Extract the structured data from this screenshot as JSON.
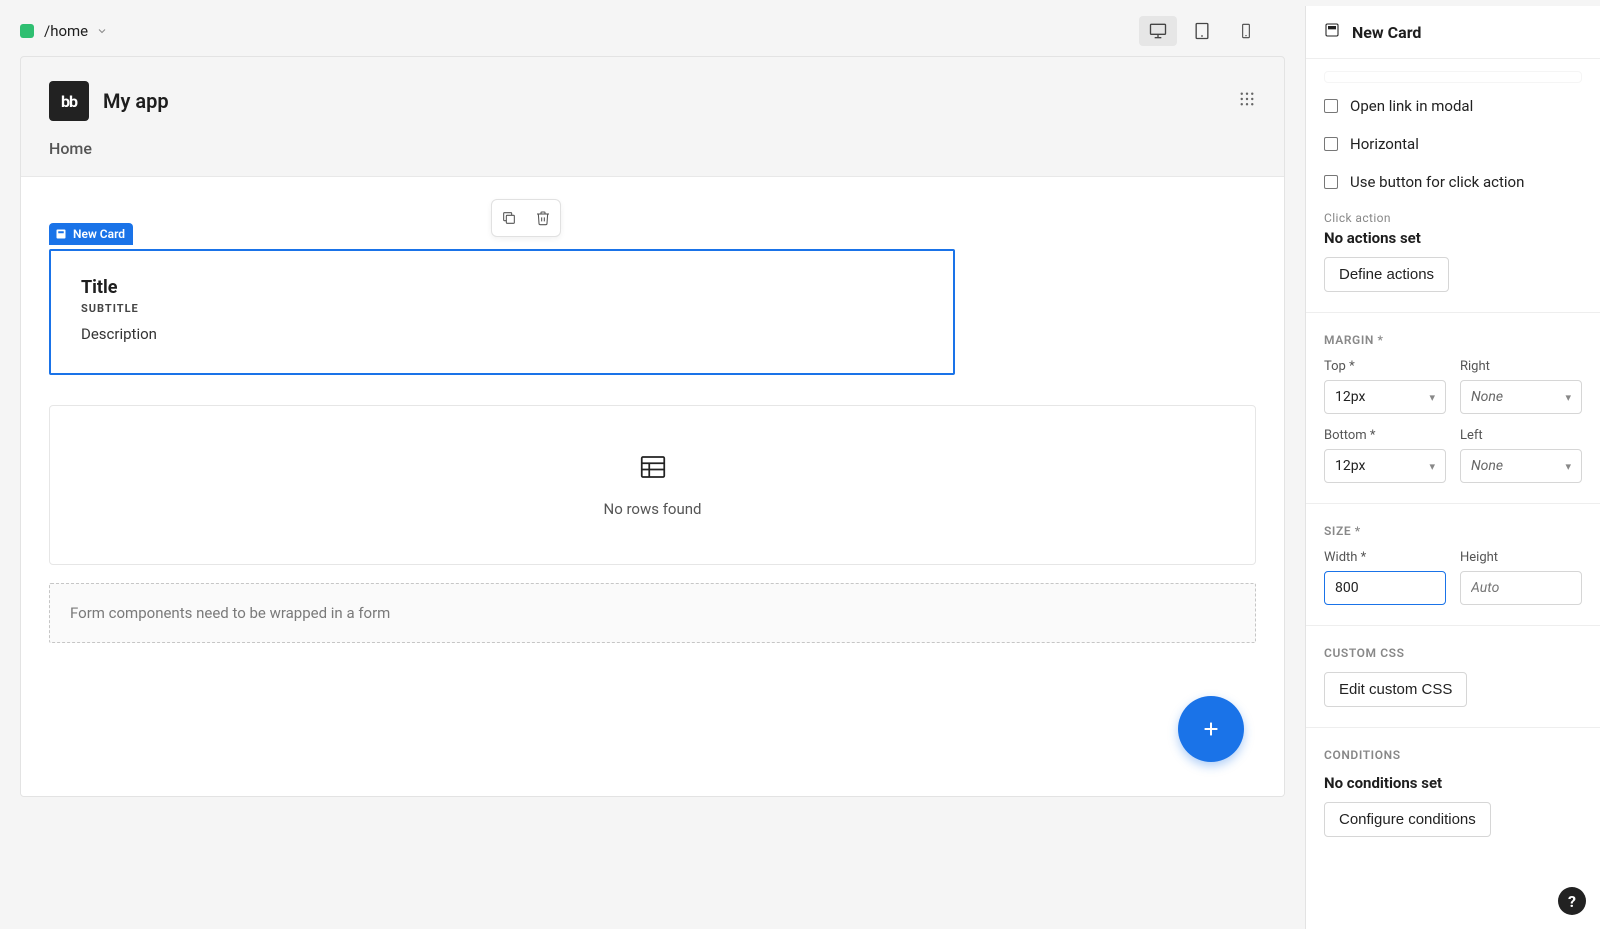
{
  "breadcrumb": {
    "path": "/home"
  },
  "app": {
    "logo_text": "bb",
    "title": "My app",
    "nav": {
      "home": "Home"
    }
  },
  "card": {
    "tag": "New Card",
    "title": "Title",
    "subtitle": "SUBTITLE",
    "description": "Description"
  },
  "table": {
    "empty_text": "No rows found"
  },
  "form_warning": "Form components need to be wrapped in a form",
  "inspector": {
    "title": "New Card",
    "checks": {
      "open_modal": "Open link in modal",
      "horizontal": "Horizontal",
      "use_button": "Use button for click action"
    },
    "click_action": {
      "label": "Click action",
      "status": "No actions set",
      "button": "Define actions"
    },
    "margin": {
      "title": "MARGIN *",
      "top_label": "Top *",
      "right_label": "Right",
      "bottom_label": "Bottom *",
      "left_label": "Left",
      "top_value": "12px",
      "right_value": "None",
      "bottom_value": "12px",
      "left_value": "None"
    },
    "size": {
      "title": "SIZE *",
      "width_label": "Width *",
      "height_label": "Height",
      "width_value": "800",
      "height_placeholder": "Auto"
    },
    "custom_css": {
      "title": "CUSTOM CSS",
      "button": "Edit custom CSS"
    },
    "conditions": {
      "title": "CONDITIONS",
      "status": "No conditions set",
      "button": "Configure conditions"
    }
  }
}
